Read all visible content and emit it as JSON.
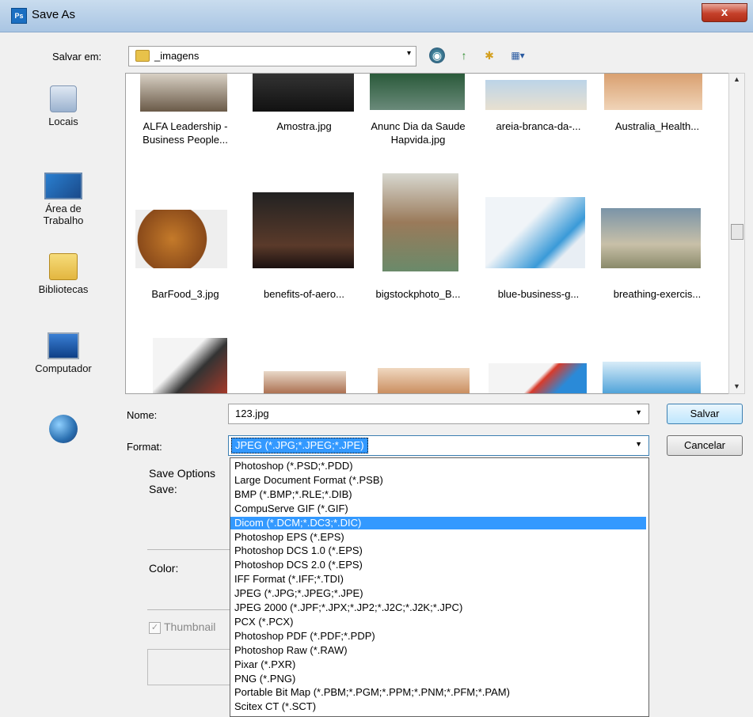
{
  "window": {
    "title": "Save As",
    "app_icon": "Ps",
    "close_glyph": "x"
  },
  "location": {
    "label": "Salvar em:",
    "folder": "_imagens",
    "arrow": "▾"
  },
  "toolbar": {
    "back": "◉",
    "up": "↑",
    "new_folder": "✱",
    "views": "▦▾"
  },
  "places": [
    {
      "label": "Locais"
    },
    {
      "label": "Área de Trabalho"
    },
    {
      "label": "Bibliotecas"
    },
    {
      "label": "Computador"
    }
  ],
  "files": [
    {
      "name": "ALFA Leadership - Business People..."
    },
    {
      "name": "Amostra.jpg"
    },
    {
      "name": "Anunc Dia da Saude Hapvida.jpg"
    },
    {
      "name": "areia-branca-da-..."
    },
    {
      "name": "Australia_Health..."
    },
    {
      "name": "BarFood_3.jpg"
    },
    {
      "name": "benefits-of-aero..."
    },
    {
      "name": "bigstockphoto_B..."
    },
    {
      "name": "blue-business-g..."
    },
    {
      "name": "breathing-exercis..."
    }
  ],
  "scrollbar": {
    "up": "▲",
    "down": "▼"
  },
  "name_field": {
    "label": "Nome:",
    "value": "123.jpg",
    "arrow": "▼"
  },
  "format_field": {
    "label": "Format:",
    "value": "JPEG (*.JPG;*.JPEG;*.JPE)",
    "arrow": "▼"
  },
  "buttons": {
    "save": "Salvar",
    "cancel": "Cancelar"
  },
  "save_options": {
    "title": "Save Options",
    "save": "Save:",
    "color": "Color:",
    "thumbnail": "Thumbnail",
    "check": "✓"
  },
  "format_options": [
    "Photoshop (*.PSD;*.PDD)",
    "Large Document Format (*.PSB)",
    "BMP (*.BMP;*.RLE;*.DIB)",
    "CompuServe GIF (*.GIF)",
    "Dicom (*.DCM;*.DC3;*.DIC)",
    "Photoshop EPS (*.EPS)",
    "Photoshop DCS 1.0 (*.EPS)",
    "Photoshop DCS 2.0 (*.EPS)",
    "IFF Format (*.IFF;*.TDI)",
    "JPEG (*.JPG;*.JPEG;*.JPE)",
    "JPEG 2000 (*.JPF;*.JPX;*.JP2;*.J2C;*.J2K;*.JPC)",
    "PCX (*.PCX)",
    "Photoshop PDF (*.PDF;*.PDP)",
    "Photoshop Raw (*.RAW)",
    "Pixar (*.PXR)",
    "PNG (*.PNG)",
    "Portable Bit Map (*.PBM;*.PGM;*.PPM;*.PNM;*.PFM;*.PAM)",
    "Scitex CT (*.SCT)"
  ],
  "selected_format_index": 4,
  "colors": {
    "selection": "#3399ff",
    "title_bar": "#b8d1ea",
    "close": "#c5402a"
  }
}
